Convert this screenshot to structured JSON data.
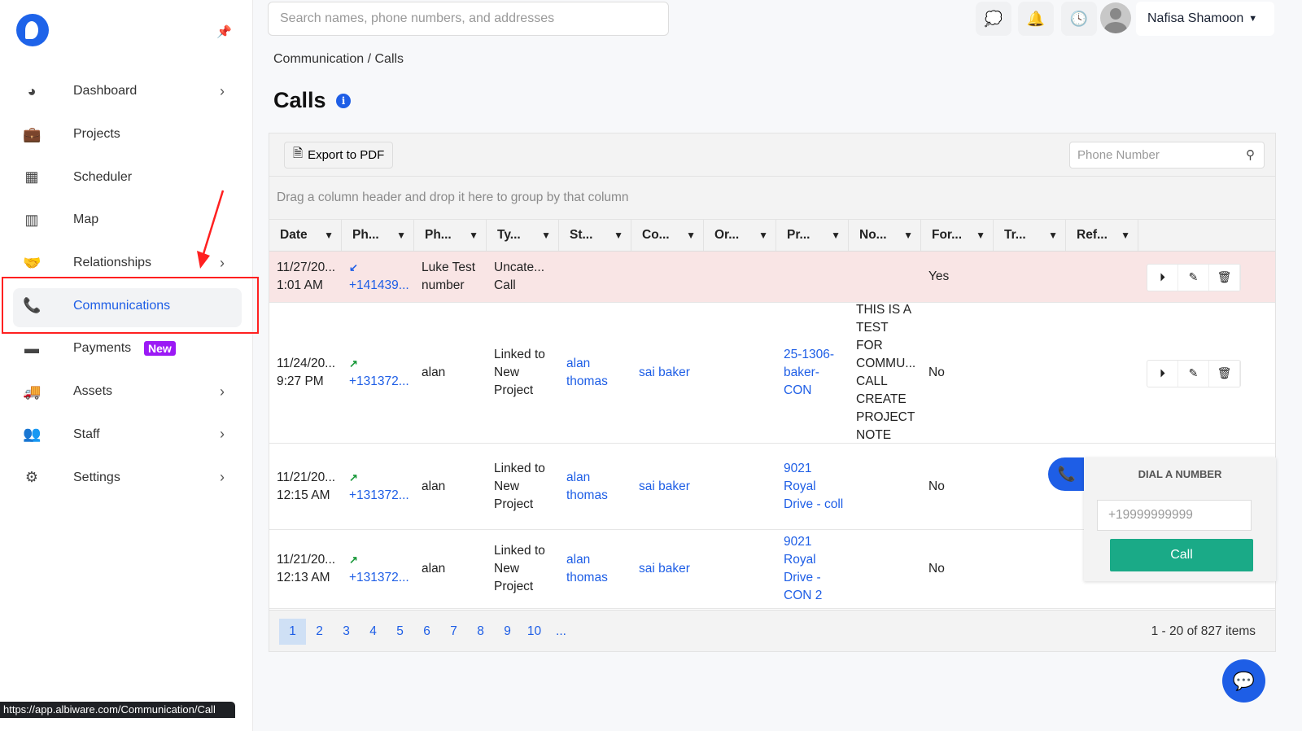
{
  "sidebar": {
    "items": [
      {
        "label": "Dashboard",
        "icon": "dashboard-icon",
        "chevron": true
      },
      {
        "label": "Projects",
        "icon": "briefcase-icon"
      },
      {
        "label": "Scheduler",
        "icon": "calendar-icon"
      },
      {
        "label": "Map",
        "icon": "map-icon"
      },
      {
        "label": "Relationships",
        "icon": "handshake-icon",
        "chevron": true
      },
      {
        "label": "Communications",
        "icon": "phone-icon",
        "active": true
      },
      {
        "label": "Payments",
        "icon": "wallet-icon",
        "badge": "New"
      },
      {
        "label": "Assets",
        "icon": "truck-icon",
        "chevron": true
      },
      {
        "label": "Staff",
        "icon": "users-icon",
        "chevron": true
      },
      {
        "label": "Settings",
        "icon": "gear-icon",
        "chevron": true
      }
    ]
  },
  "status_url": "https://app.albiware.com/Communication/Call",
  "header": {
    "search_placeholder": "Search names, phone numbers, and addresses",
    "user_name": "Nafisa Shamoon"
  },
  "breadcrumb": "Communication / Calls",
  "page_title": "Calls",
  "toolbar": {
    "export_label": "Export to PDF",
    "phone_placeholder": "Phone Number"
  },
  "group_hint": "Drag a column header and drop it here to group by that column",
  "columns": [
    "Date",
    "Ph...",
    "Ph...",
    "Ty...",
    "St...",
    "Co...",
    "Or...",
    "Pr...",
    "No...",
    "For...",
    "Tr...",
    "Ref..."
  ],
  "rows": [
    {
      "date": "11/27/20...",
      "time": "1:01 AM",
      "direction": "incoming",
      "phone": "+141439...",
      "phone_name": "Luke Test number",
      "type": "Uncate... Call",
      "staff": "",
      "contact": "",
      "org": "",
      "project": "",
      "notes": "",
      "forwarded": "Yes",
      "highlight": true
    },
    {
      "date": "11/24/20...",
      "time": "9:27 PM",
      "direction": "outgoing",
      "phone": "+131372...",
      "phone_name": "alan",
      "type": "Linked to New Project",
      "staff": "alan thomas",
      "contact": "sai baker",
      "org": "",
      "project": "25-1306-baker-CON",
      "notes": "THIS IS A TEST FOR COMMU... CALL CREATE PROJECT NOTE",
      "forwarded": "No"
    },
    {
      "date": "11/21/20...",
      "time": "12:15 AM",
      "direction": "outgoing",
      "phone": "+131372...",
      "phone_name": "alan",
      "type": "Linked to New Project",
      "staff": "alan thomas",
      "contact": "sai baker",
      "org": "",
      "project": "9021 Royal Drive - coll",
      "notes": "",
      "forwarded": "No"
    },
    {
      "date": "11/21/20...",
      "time": "12:13 AM",
      "direction": "outgoing",
      "phone": "+131372...",
      "phone_name": "alan",
      "type": "Linked to New Project",
      "staff": "alan thomas",
      "contact": "sai baker",
      "org": "",
      "project": "9021 Royal Drive - CON 2",
      "notes": "",
      "forwarded": "No"
    }
  ],
  "pagination": {
    "pages": [
      "1",
      "2",
      "3",
      "4",
      "5",
      "6",
      "7",
      "8",
      "9",
      "10",
      "..."
    ],
    "current": "1",
    "info": "1 - 20 of 827 items"
  },
  "dialer": {
    "title": "DIAL A NUMBER",
    "placeholder": "+19999999999",
    "call_label": "Call"
  },
  "colors": {
    "accent": "#1e5ee6",
    "highlight_row": "#f9e5e5",
    "badge": "#9b19f5",
    "call_button": "#1aaa87",
    "annotation": "#ff2020"
  }
}
